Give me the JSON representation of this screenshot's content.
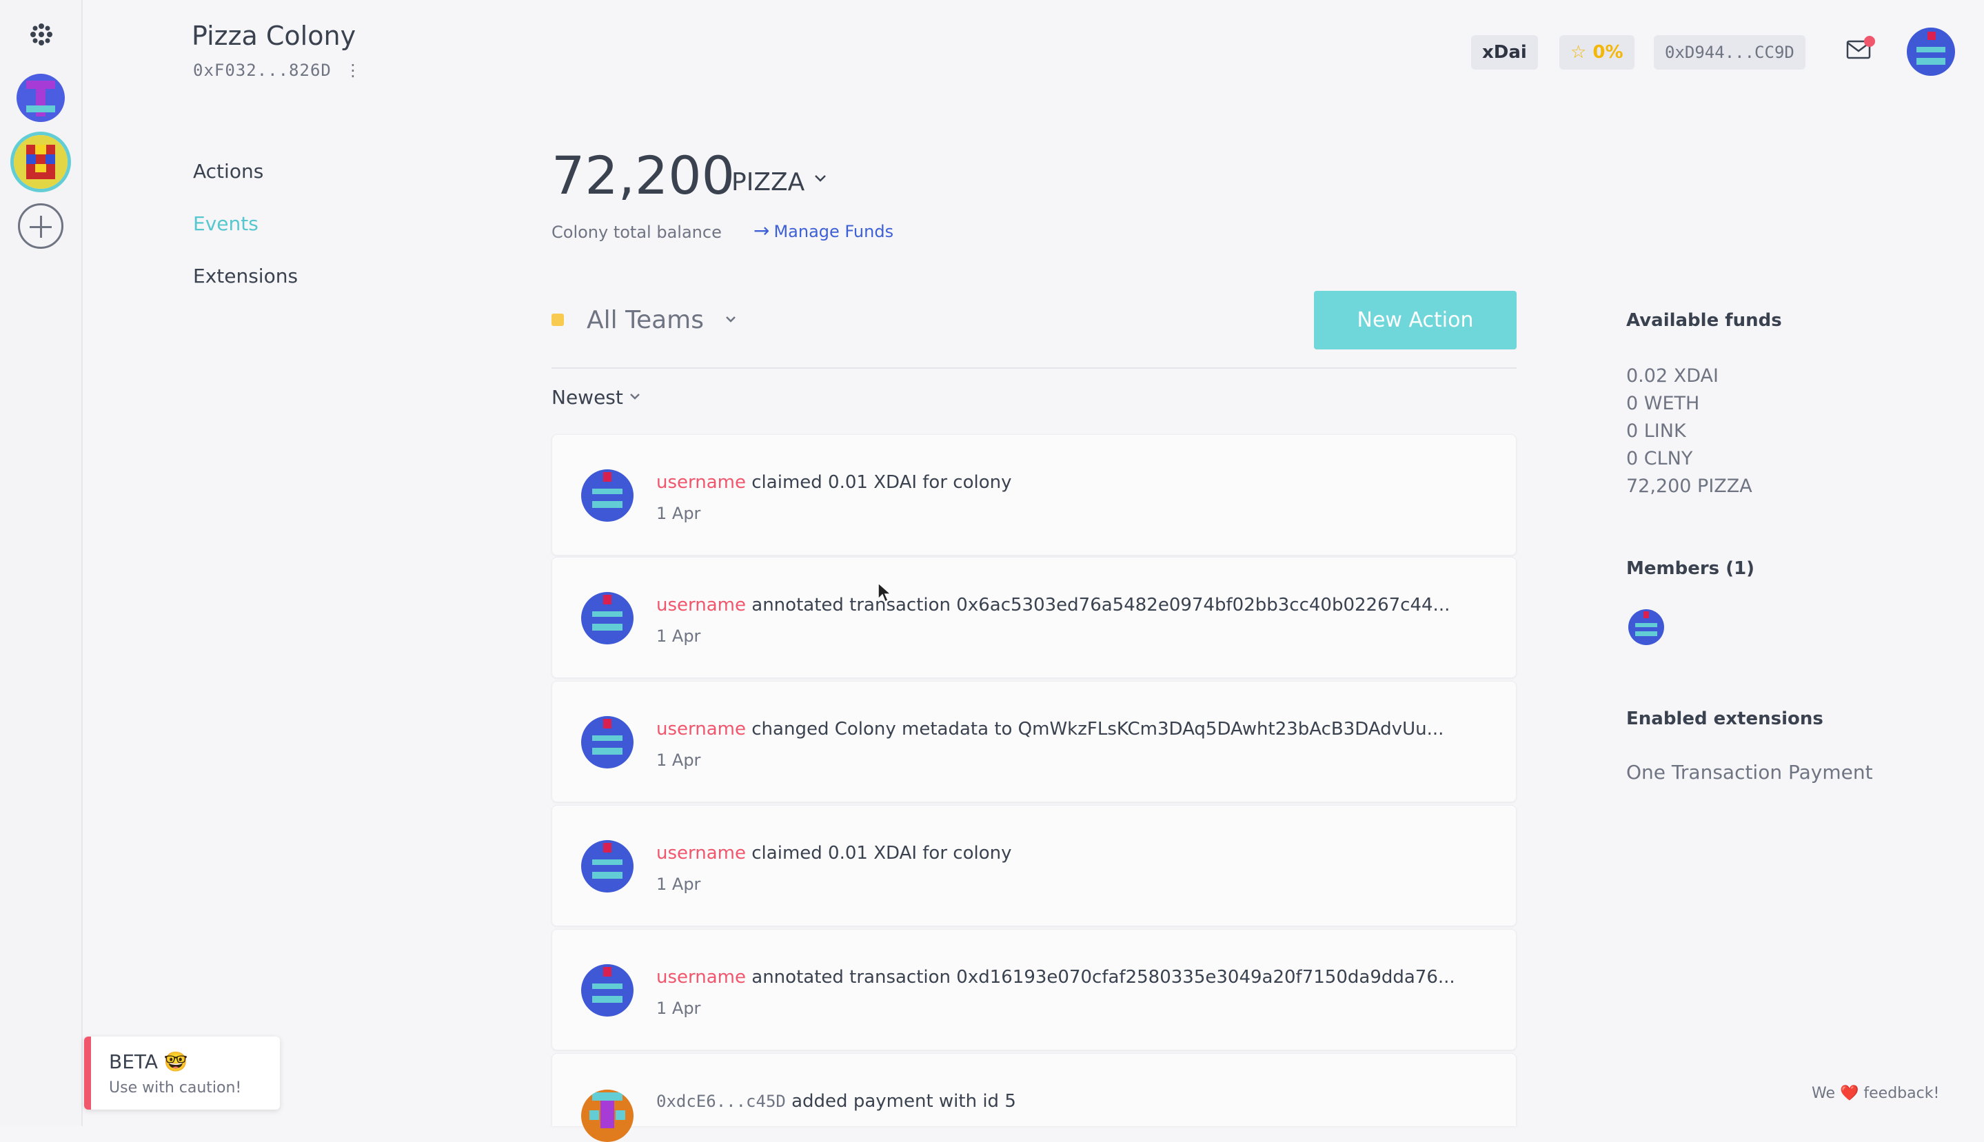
{
  "colony": {
    "name": "Pizza Colony",
    "address": "0xF032...826D",
    "more": "⋮"
  },
  "header": {
    "network": "xDai",
    "reputation": "☆ 0%",
    "wallet": "0xD944...CC9D",
    "notification_dot_color": "#f0566c"
  },
  "subnav": {
    "items": [
      {
        "label": "Actions"
      },
      {
        "label": "Events",
        "active": true
      },
      {
        "label": "Extensions"
      }
    ]
  },
  "balance": {
    "amount": "72,200",
    "token": "PIZZA",
    "label": "Colony total balance",
    "manage_funds": "Manage Funds",
    "arrow": "→"
  },
  "team_bar": {
    "team": "All Teams",
    "team_color": "#f9ca50",
    "new_action": "New Action",
    "sort": "Newest"
  },
  "events": [
    {
      "user": "username",
      "text": "claimed 0.01 XDAI for colony",
      "date": "1 Apr"
    },
    {
      "user": "username",
      "text": "annotated transaction 0x6ac5303ed76a5482e0974bf02bb3cc40b02267c44...",
      "date": "1 Apr"
    },
    {
      "user": "username",
      "text": "changed Colony metadata to QmWkzFLsKCm3DAq5DAwht23bAcB3DAdvUu...",
      "date": "1 Apr"
    },
    {
      "user": "username",
      "text": "claimed 0.01 XDAI for colony",
      "date": "1 Apr"
    },
    {
      "user": "username",
      "text": "annotated transaction 0xd16193e070cfaf2580335e3049a20f7150da9dda76...",
      "date": "1 Apr"
    },
    {
      "user": "0xdcE6...c45D",
      "text": "added payment with id 5",
      "date": ""
    }
  ],
  "sidebar_right": {
    "funds_title": "Available funds",
    "funds": [
      "0.02 XDAI",
      "0 WETH",
      "0 LINK",
      "0 CLNY",
      "72,200 PIZZA"
    ],
    "members_title": "Members (1)",
    "extensions_title": "Enabled extensions",
    "extensions": [
      "One Transaction Payment"
    ]
  },
  "beta": {
    "title": "BETA 🤓",
    "subtitle": "Use with caution!"
  },
  "feedback": {
    "pre": "We",
    "heart": "❤️",
    "post": "feedback!"
  },
  "icons": {
    "logo": "colony-logo-icon",
    "add": "plus-circle-icon",
    "inbox": "envelope-icon",
    "chevron": "chevron-down-icon"
  },
  "colors": {
    "accent": "#56c7cf",
    "button": "#6fd6da",
    "link": "#3e60d7",
    "username": "#f0566c",
    "reputation": "#f3b70a"
  }
}
